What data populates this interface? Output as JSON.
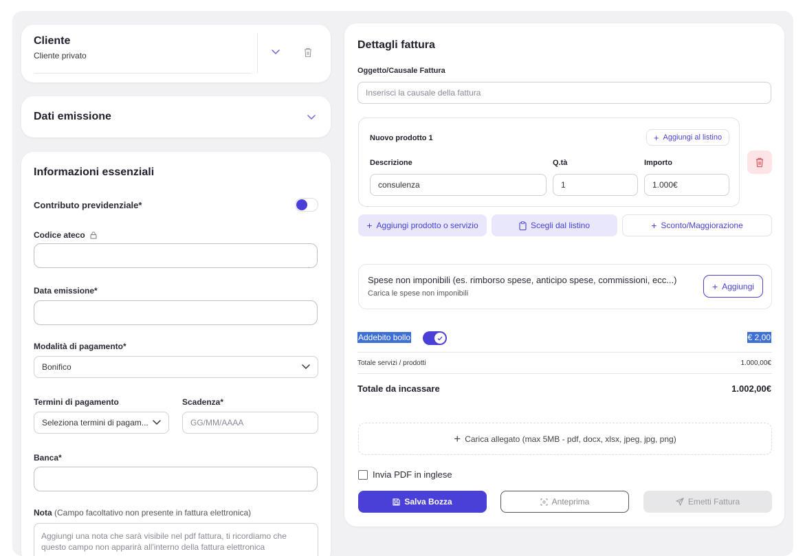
{
  "cliente": {
    "title": "Cliente",
    "subtitle": "Cliente privato"
  },
  "dati_emissione": {
    "title": "Dati emissione"
  },
  "info": {
    "title": "Informazioni essenziali",
    "contributo_label": "Contributo previdenziale*",
    "ateco_label": "Codice ateco",
    "ateco_value": "",
    "data_label": "Data emissione*",
    "data_value": "",
    "modalita_label": "Modalità di pagamento*",
    "modalita_value": "Bonifico",
    "termini_label": "Termini di pagamento",
    "termini_value": "Seleziona termini di pagam...",
    "scadenza_label": "Scadenza*",
    "scadenza_placeholder": "GG/MM/AAAA",
    "banca_label": "Banca*",
    "banca_value": "",
    "nota_label": "Nota",
    "nota_hint": "(Campo facoltativo non presente in fattura elettronica)",
    "nota_placeholder": "Aggiungi una nota che sarà visibile nel pdf fattura, ti ricordiamo che questo campo non apparirà all'interno della fattura elettronica"
  },
  "dettagli": {
    "title": "Dettagli fattura",
    "oggetto_label": "Oggetto/Causale Fattura",
    "oggetto_placeholder": "Inserisci la causale della fattura",
    "product": {
      "title": "Nuovo prodotto 1",
      "add_listino": "Aggiungi al listino",
      "desc_label": "Descrizione",
      "desc_value": "consulenza",
      "qta_label": "Q.tà",
      "qta_value": "1",
      "importo_label": "Importo",
      "importo_value": "1.000€"
    },
    "add_prodotto": "Aggiungi prodotto o servizio",
    "scegli_listino": "Scegli dal listino",
    "sconto": "Sconto/Maggiorazione",
    "spese_title": "Spese non imponibili (es. rimborso spese, anticipo spese, commissioni, ecc...)",
    "spese_subtitle": "Carica le spese non imponibili",
    "spese_add": "Aggiungi",
    "bollo_label": "Addebito bollo",
    "bollo_value": "€ 2,00",
    "totale_servizi_label": "Totale servizi / prodotti",
    "totale_servizi_value": "1.000,00€",
    "totale_label": "Totale da incassare",
    "totale_value": "1.002,00€",
    "allegato": "Carica allegato (max 5MB - pdf, docx, xlsx, jpeg, jpg, png)",
    "invia_inglese": "Invia PDF in inglese",
    "salva": "Salva Bozza",
    "anteprima": "Anteprima",
    "emetti": "Emetti Fattura"
  },
  "colors": {
    "accent": "#4a3fd6",
    "accent_light": "#e8e7fb",
    "danger_bg": "#fde4e6",
    "danger": "#e0555f",
    "highlight": "#3d6fd4"
  }
}
